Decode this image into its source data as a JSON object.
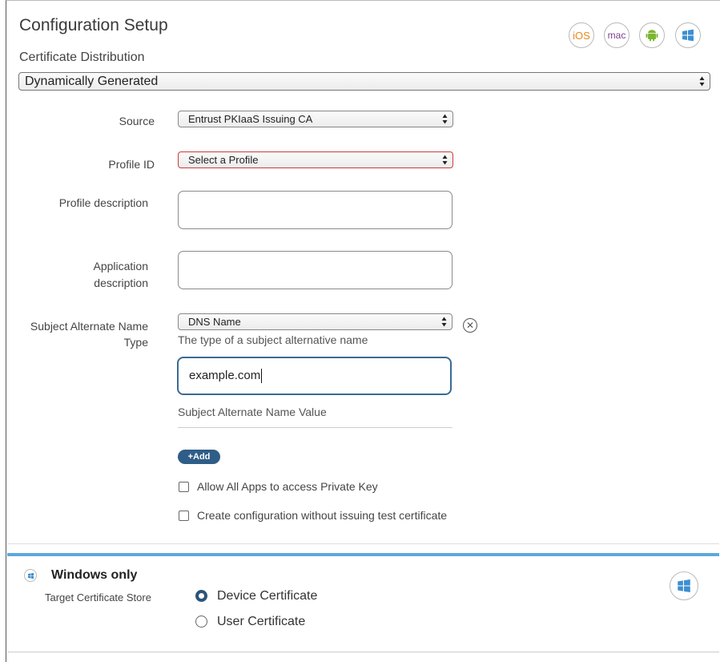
{
  "header": {
    "title": "Configuration Setup",
    "subtitle": "Certificate Distribution",
    "os_icons": [
      {
        "label": "iOS",
        "color": "#e8891d"
      },
      {
        "label": "mac",
        "color": "#7a3f8f"
      },
      {
        "icon": "android-icon",
        "color": "#7cb631"
      },
      {
        "icon": "windows-icon",
        "color": "#3d8fd1"
      }
    ]
  },
  "distribution": {
    "selected": "Dynamically Generated"
  },
  "form": {
    "source": {
      "label": "Source",
      "value": "Entrust PKIaaS Issuing CA"
    },
    "profile_id": {
      "label": "Profile ID",
      "value": "Select a Profile"
    },
    "profile_description": {
      "label": "Profile description",
      "value": ""
    },
    "application_description": {
      "label_line1": "Application",
      "label_line2": "description",
      "value": ""
    },
    "san_type": {
      "label_line1": "Subject Alternate Name",
      "label_line2": "Type",
      "value": "DNS Name",
      "hint": "The type of a subject alternative name"
    },
    "san_value": {
      "value": "example.com",
      "hint": "Subject Alternate Name Value"
    },
    "add_label": "+Add",
    "checkboxes": [
      {
        "label": "Allow All Apps to access Private Key",
        "checked": false
      },
      {
        "label": "Create configuration without issuing test certificate",
        "checked": false
      }
    ]
  },
  "windows": {
    "title": "Windows only",
    "store_label": "Target Certificate Store",
    "options": [
      {
        "label": "Device Certificate",
        "selected": true
      },
      {
        "label": "User Certificate",
        "selected": false
      }
    ]
  }
}
